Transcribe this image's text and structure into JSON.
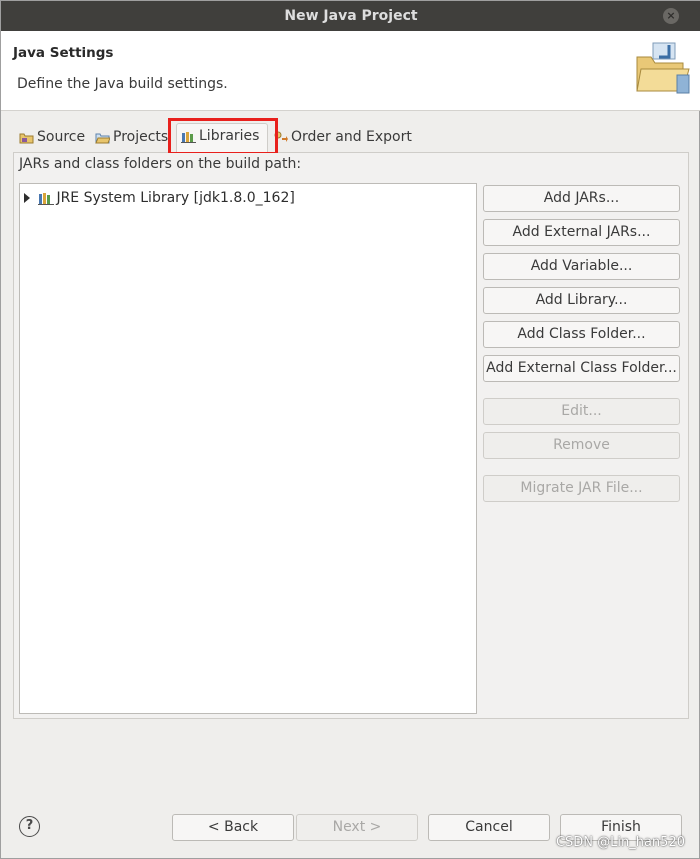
{
  "window": {
    "title": "New Java Project",
    "close_glyph": "×"
  },
  "header": {
    "title": "Java Settings",
    "description": "Define the Java build settings."
  },
  "tabs": [
    {
      "label": "Source",
      "icon": "source-folder-icon"
    },
    {
      "label": "Projects",
      "icon": "projects-folder-icon"
    },
    {
      "label": "Libraries",
      "icon": "libraries-icon",
      "selected": true
    },
    {
      "label": "Order and Export",
      "icon": "order-export-icon"
    }
  ],
  "panel": {
    "label": "JARs and class folders on the build path:",
    "tree": [
      {
        "label": "JRE System Library [jdk1.8.0_162]",
        "expanded": false
      }
    ]
  },
  "buttons": [
    {
      "label": "Add JARs...",
      "enabled": true
    },
    {
      "label": "Add External JARs...",
      "enabled": true
    },
    {
      "label": "Add Variable...",
      "enabled": true
    },
    {
      "label": "Add Library...",
      "enabled": true
    },
    {
      "label": "Add Class Folder...",
      "enabled": true
    },
    {
      "label": "Add External Class Folder...",
      "enabled": true
    },
    {
      "label": "Edit...",
      "enabled": false
    },
    {
      "label": "Remove",
      "enabled": false
    },
    {
      "label": "Migrate JAR File...",
      "enabled": false
    }
  ],
  "footer": {
    "help": "?",
    "back": "< Back",
    "next": "Next >",
    "cancel": "Cancel",
    "finish": "Finish"
  },
  "watermark": "CSDN @Lin_han520",
  "colors": {
    "highlight": "#e8201c",
    "titlebar": "#403f3c"
  }
}
